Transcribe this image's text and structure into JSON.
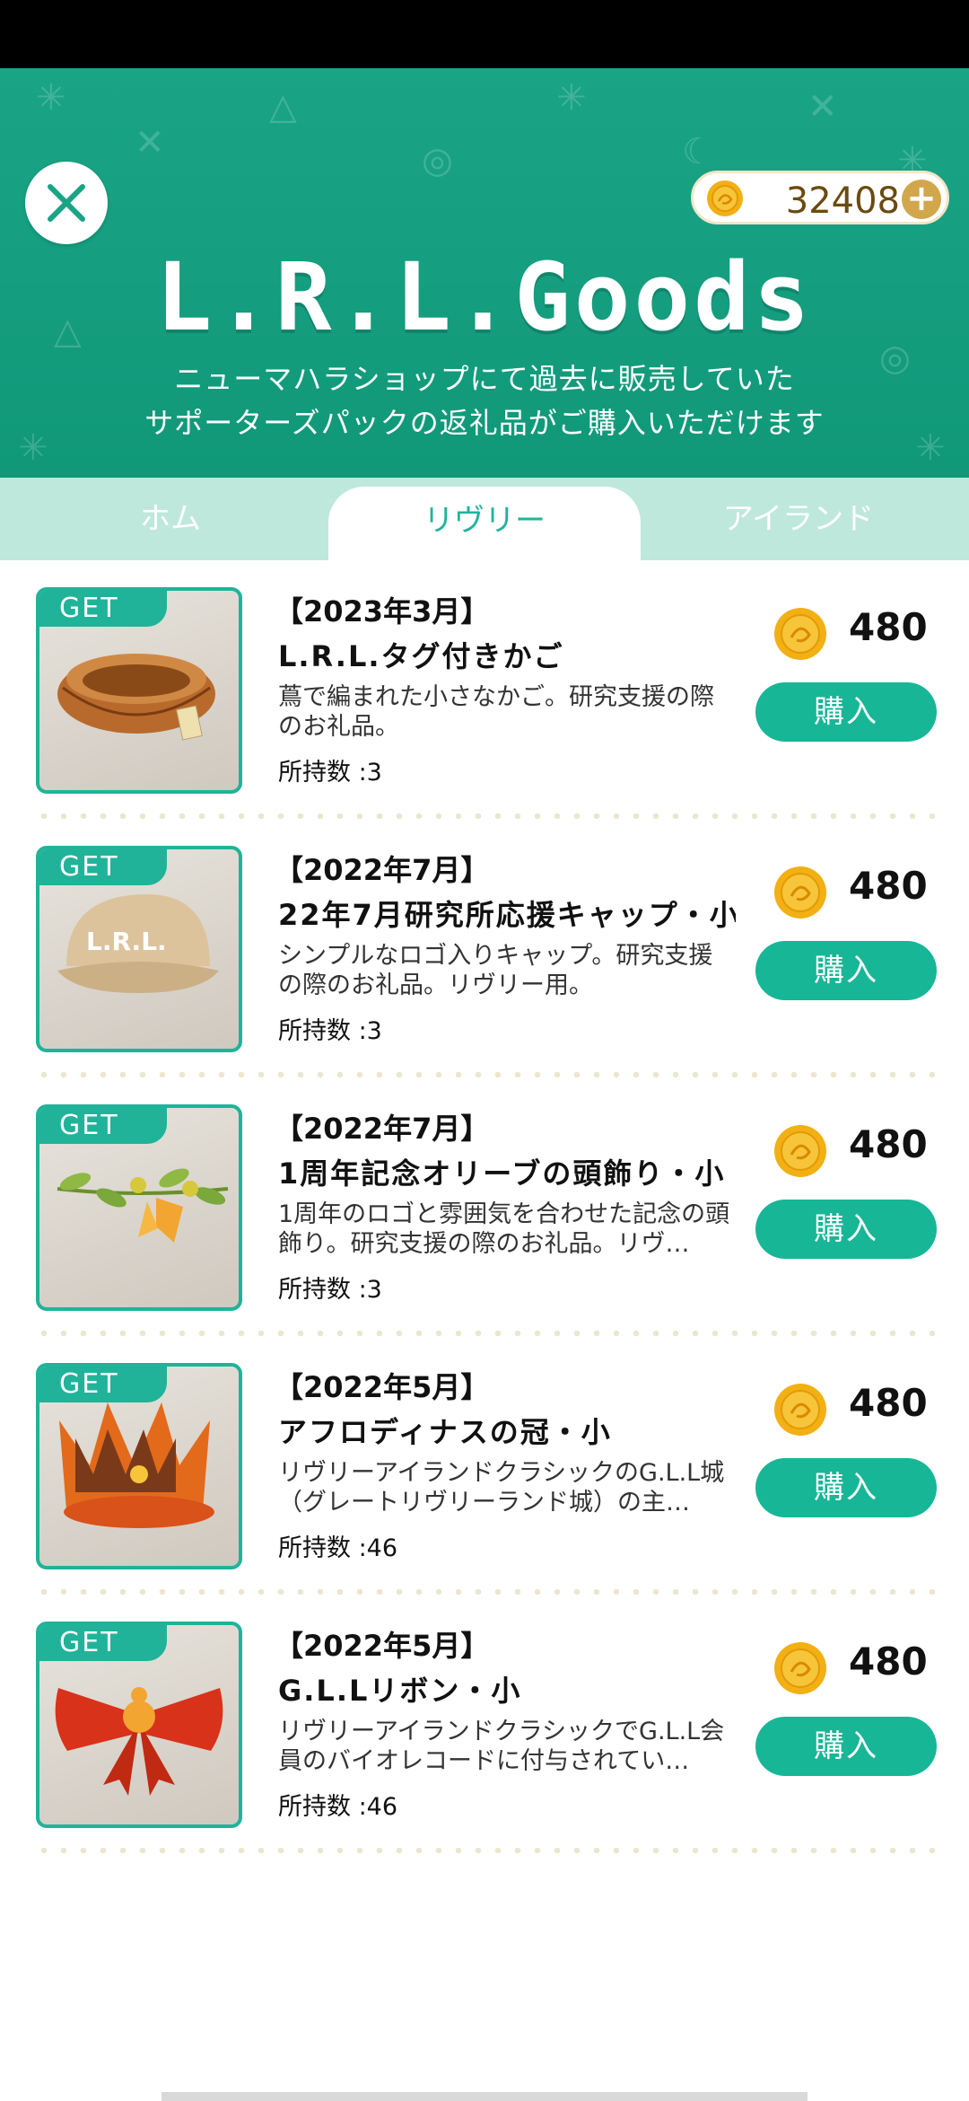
{
  "header": {
    "balance": "32408",
    "logo_text": "L.R.L.Goods",
    "subtitle_line1": "ニューマハラショップにて過去に販売していた",
    "subtitle_line2": "サポーターズパックの返礼品がご購入いただけます"
  },
  "tabs": [
    "ホム",
    "リヴリー",
    "アイランド"
  ],
  "colors": {
    "accent": "#17b697",
    "header": "#1aa486",
    "tab_bar": "#bfe8dd",
    "coin": "#f2b014"
  },
  "badge": "GET",
  "items": [
    {
      "date": "【2023年3月】",
      "name": "L.R.L.タグ付きかご",
      "desc": "蔦で編まれた小さなかご。研究支援の際のお礼品。",
      "owned": "所持数 :3",
      "price": "480",
      "buy": "購入",
      "icon": "basket-icon"
    },
    {
      "date": "【2022年7月】",
      "name": "22年7月研究所応援キャップ・小",
      "desc": "シンプルなロゴ入りキャップ。研究支援の際のお礼品。リヴリー用。",
      "owned": "所持数 :3",
      "price": "480",
      "buy": "購入",
      "icon": "cap-icon"
    },
    {
      "date": "【2022年7月】",
      "name": "1周年記念オリーブの頭飾り・小",
      "desc": "1周年のロゴと雰囲気を合わせた記念の頭飾り。研究支援の際のお礼品。リヴ…",
      "owned": "所持数 :3",
      "price": "480",
      "buy": "購入",
      "icon": "olive-icon"
    },
    {
      "date": "【2022年5月】",
      "name": "アフロディナスの冠・小",
      "desc": "リヴリーアイランドクラシックのG.L.L城（グレートリヴリーランド城）の主…",
      "owned": "所持数 :46",
      "price": "480",
      "buy": "購入",
      "icon": "crown-icon"
    },
    {
      "date": "【2022年5月】",
      "name": "G.L.Lリボン・小",
      "desc": "リヴリーアイランドクラシックでG.L.L会員のバイオレコードに付与されてい…",
      "owned": "所持数 :46",
      "price": "480",
      "buy": "購入",
      "icon": "ribbon-icon"
    }
  ]
}
